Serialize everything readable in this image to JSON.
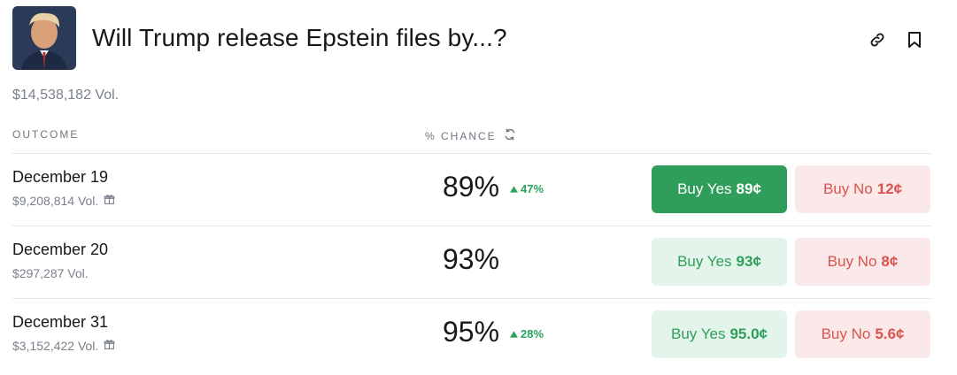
{
  "market": {
    "title": "Will Trump release Epstein files by...?",
    "total_volume": "$14,538,182 Vol."
  },
  "columns": {
    "outcome": "OUTCOME",
    "chance": "% CHANCE"
  },
  "icons": {
    "link": "link-icon",
    "bookmark": "bookmark-icon",
    "refresh": "refresh-icon",
    "gift": "gift-icon",
    "up": "triangle-up-icon"
  },
  "colors": {
    "yes_bg": "#e3f5ea",
    "yes_active": "#2f9e5b",
    "no_bg": "#fbe9e9",
    "no_text": "#d9534f",
    "up": "#27a35a"
  },
  "outcomes": [
    {
      "name": "December 19",
      "volume": "$9,208,814 Vol.",
      "chance": "89%",
      "delta": "47%",
      "yes_label": "Buy Yes",
      "yes_price": "89¢",
      "no_label": "Buy No",
      "no_price": "12¢"
    },
    {
      "name": "December 20",
      "volume": "$297,287 Vol.",
      "chance": "93%",
      "delta": "",
      "yes_label": "Buy Yes",
      "yes_price": "93¢",
      "no_label": "Buy No",
      "no_price": "8¢"
    },
    {
      "name": "December 31",
      "volume": "$3,152,422 Vol.",
      "chance": "95%",
      "delta": "28%",
      "yes_label": "Buy Yes",
      "yes_price": "95.0¢",
      "no_label": "Buy No",
      "no_price": "5.6¢"
    }
  ]
}
